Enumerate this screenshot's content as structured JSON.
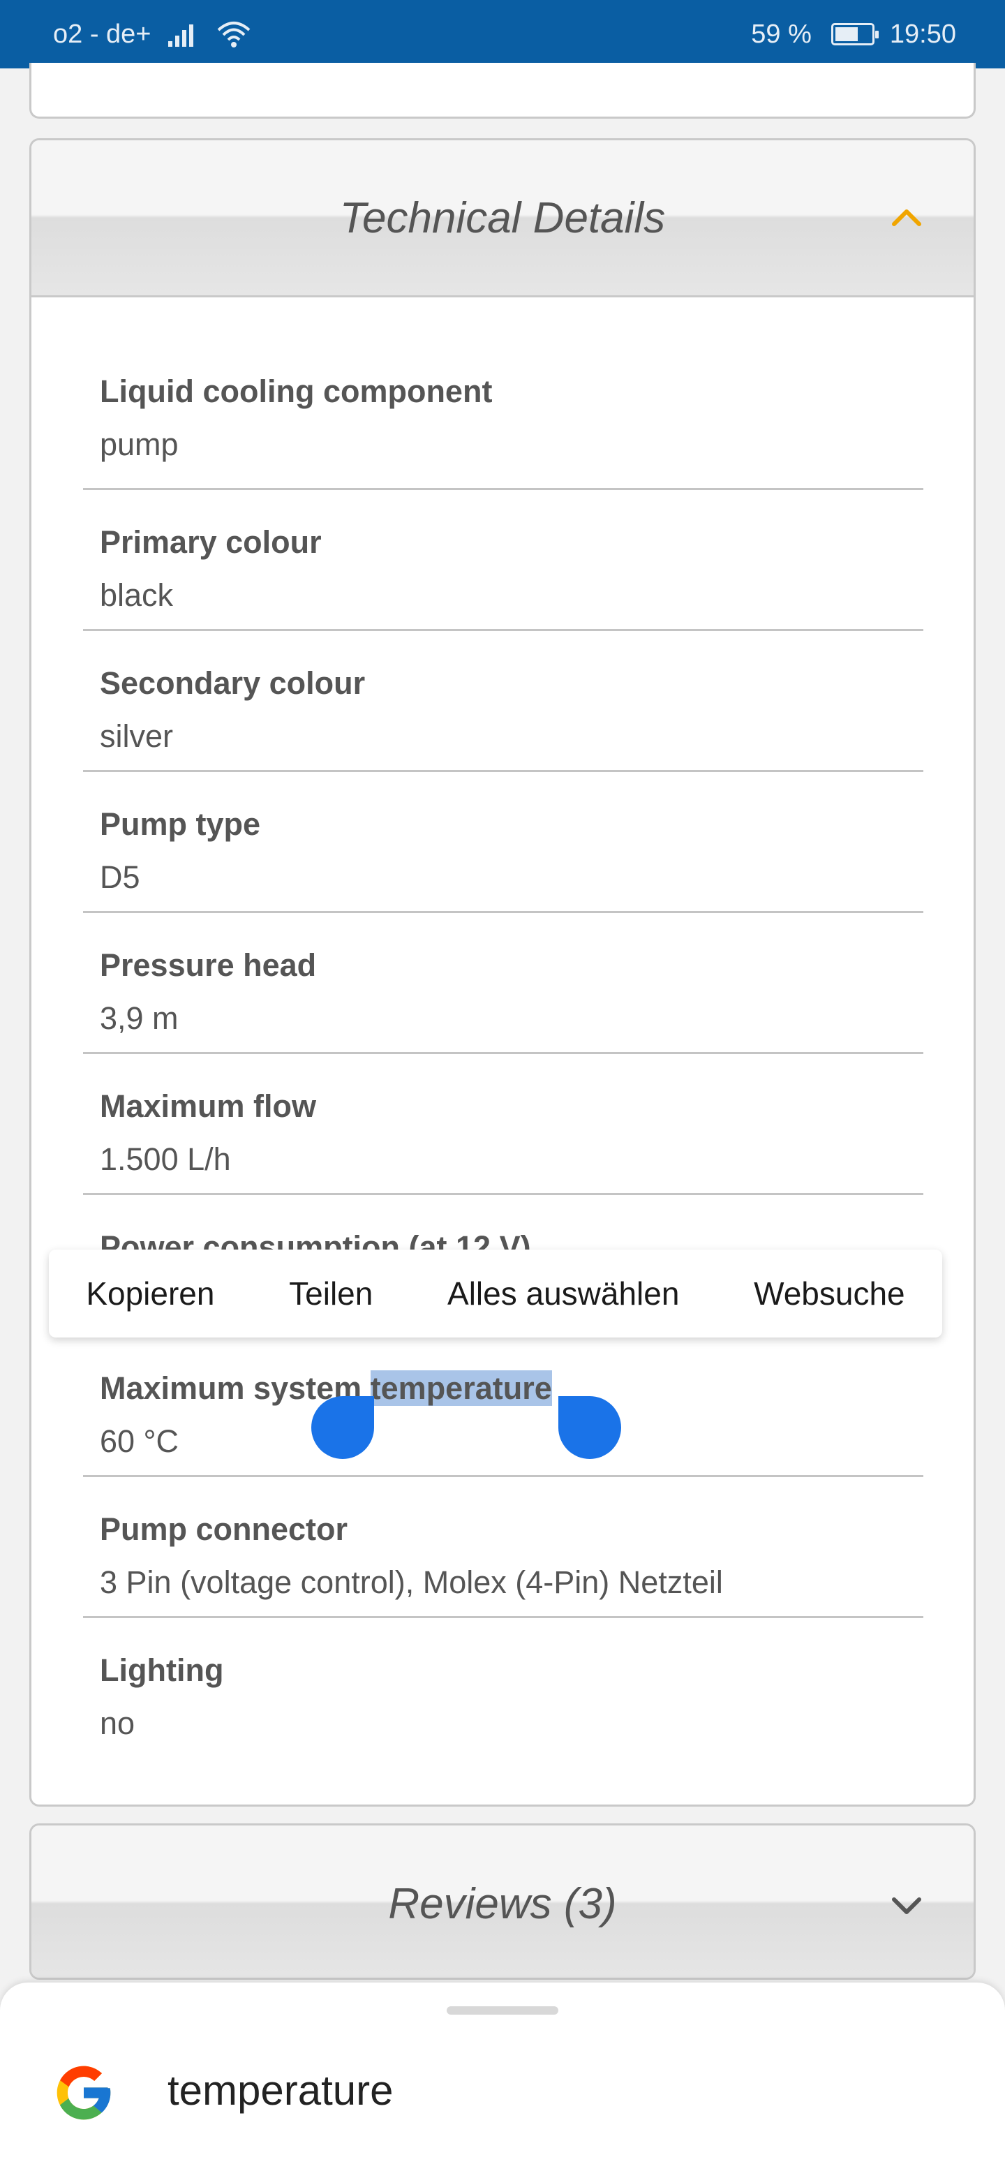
{
  "status_bar": {
    "carrier": "o2 - de+",
    "battery": "59 %",
    "time": "19:50"
  },
  "technical_details": {
    "title": "Technical Details",
    "items": [
      {
        "label": "Liquid cooling component",
        "value": "pump"
      },
      {
        "label": "Primary colour",
        "value": "black"
      },
      {
        "label": "Secondary colour",
        "value": "silver"
      },
      {
        "label": "Pump type",
        "value": "D5"
      },
      {
        "label": "Pressure head",
        "value": "3,9 m"
      },
      {
        "label": "Maximum flow",
        "value": "1.500 L/h"
      },
      {
        "label": "Power consumption (at 12 V)",
        "value": ""
      },
      {
        "label_prefix": "Maximum system ",
        "label_selected": "temperature",
        "value": "60 °C"
      },
      {
        "label": "Pump connector",
        "value": "3 Pin (voltage control), Molex (4-Pin) Netzteil"
      },
      {
        "label": "Lighting",
        "value": "no"
      }
    ]
  },
  "context_menu": {
    "copy": "Kopieren",
    "share": "Teilen",
    "select_all": "Alles auswählen",
    "web_search": "Websuche"
  },
  "reviews": {
    "title": "Reviews (3)"
  },
  "bottom_sheet": {
    "query": "temperature"
  },
  "colors": {
    "status_bar": "#0a5ea3",
    "accent_chevron": "#f0a500",
    "selection": "#a9c4e8",
    "handle": "#1a73e8"
  }
}
